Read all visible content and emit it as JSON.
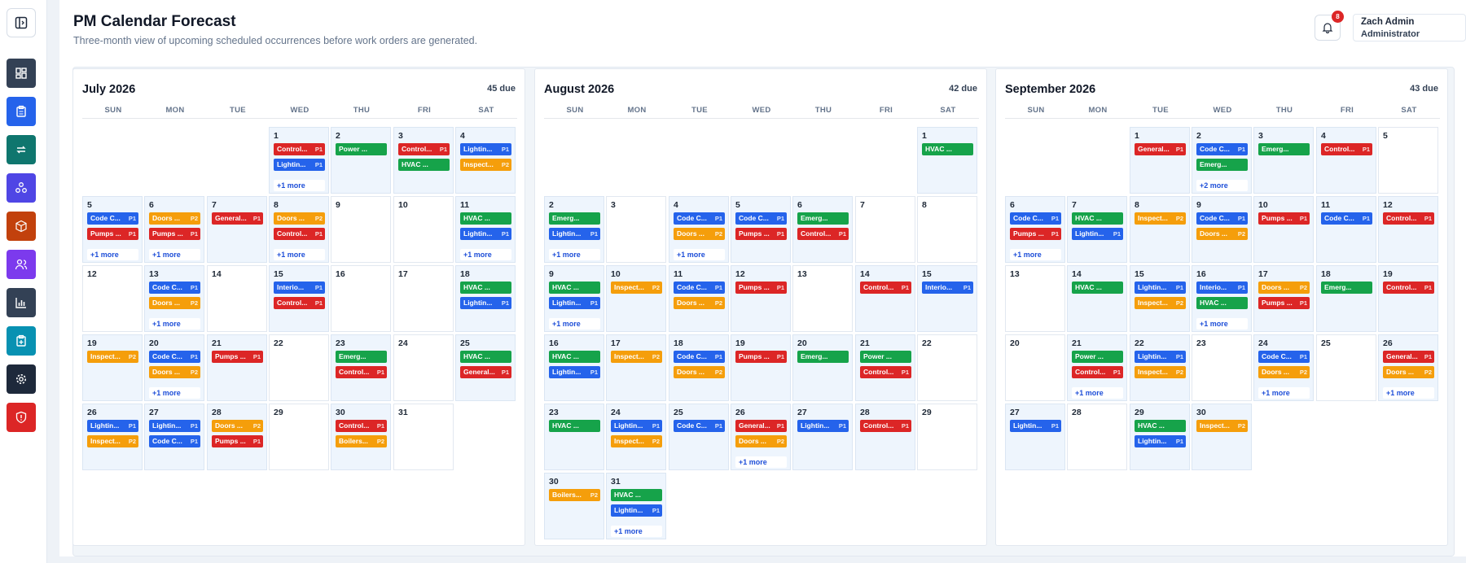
{
  "header": {
    "title": "PM Calendar Forecast",
    "subtitle": "Three-month view of upcoming scheduled occurrences before work orders are generated.",
    "notification_count": "8"
  },
  "user": {
    "name": "Zach Admin",
    "role": "Administrator"
  },
  "sidebar": {
    "items": [
      {
        "name": "dashboard",
        "icon": "grid-icon",
        "color": "#334155"
      },
      {
        "name": "work-orders",
        "icon": "clipboard-icon",
        "color": "#2563eb"
      },
      {
        "name": "pm-schedules",
        "icon": "repeat-icon",
        "color": "#0f766e"
      },
      {
        "name": "assets",
        "icon": "network-icon",
        "color": "#4f46e5"
      },
      {
        "name": "inventory",
        "icon": "box-icon",
        "color": "#c2410c"
      },
      {
        "name": "users",
        "icon": "users-icon",
        "color": "#7c3aed"
      },
      {
        "name": "reports",
        "icon": "bar-chart-icon",
        "color": "#334155"
      },
      {
        "name": "requests",
        "icon": "clipboard-plus-icon",
        "color": "#0891b2"
      },
      {
        "name": "settings",
        "icon": "gear-icon",
        "color": "#1e293b"
      },
      {
        "name": "safety",
        "icon": "shield-alert-icon",
        "color": "#dc2626"
      }
    ]
  },
  "weekdays": [
    "SUN",
    "MON",
    "TUE",
    "WED",
    "THU",
    "FRI",
    "SAT"
  ],
  "colors": {
    "blue": "#2563eb",
    "green": "#16a34a",
    "red": "#dc2626",
    "orange": "#f59e0b"
  },
  "months": [
    {
      "title": "July 2026",
      "due": "45 due",
      "start": 3,
      "days": 31,
      "events": {
        "1": {
          "c": [
            [
              "Control...",
              "P1",
              "red"
            ],
            [
              "Lightin...",
              "P1",
              "blue"
            ]
          ],
          "more": "+1 more"
        },
        "2": {
          "c": [
            [
              "Power ...",
              "",
              "green"
            ]
          ]
        },
        "3": {
          "c": [
            [
              "Control...",
              "P1",
              "red"
            ],
            [
              "HVAC ...",
              "",
              "green"
            ]
          ]
        },
        "4": {
          "c": [
            [
              "Lightin...",
              "P1",
              "blue"
            ],
            [
              "Inspect...",
              "P2",
              "orange"
            ]
          ]
        },
        "5": {
          "c": [
            [
              "Code C...",
              "P1",
              "blue"
            ],
            [
              "Pumps ...",
              "P1",
              "red"
            ]
          ],
          "more": "+1 more"
        },
        "6": {
          "c": [
            [
              "Doors ...",
              "P2",
              "orange"
            ],
            [
              "Pumps ...",
              "P1",
              "red"
            ]
          ],
          "more": "+1 more"
        },
        "7": {
          "c": [
            [
              "General...",
              "P1",
              "red"
            ]
          ]
        },
        "8": {
          "c": [
            [
              "Doors ...",
              "P2",
              "orange"
            ],
            [
              "Control...",
              "P1",
              "red"
            ]
          ],
          "more": "+1 more"
        },
        "11": {
          "c": [
            [
              "HVAC ...",
              "",
              "green"
            ],
            [
              "Lightin...",
              "P1",
              "blue"
            ]
          ],
          "more": "+1 more"
        },
        "13": {
          "c": [
            [
              "Code C...",
              "P1",
              "blue"
            ],
            [
              "Doors ...",
              "P2",
              "orange"
            ]
          ],
          "more": "+1 more"
        },
        "15": {
          "c": [
            [
              "Interio...",
              "P1",
              "blue"
            ],
            [
              "Control...",
              "P1",
              "red"
            ]
          ]
        },
        "18": {
          "c": [
            [
              "HVAC ...",
              "",
              "green"
            ],
            [
              "Lightin...",
              "P1",
              "blue"
            ]
          ]
        },
        "19": {
          "c": [
            [
              "Inspect...",
              "P2",
              "orange"
            ]
          ]
        },
        "20": {
          "c": [
            [
              "Code C...",
              "P1",
              "blue"
            ],
            [
              "Doors ...",
              "P2",
              "orange"
            ]
          ],
          "more": "+1 more"
        },
        "21": {
          "c": [
            [
              "Pumps ...",
              "P1",
              "red"
            ]
          ]
        },
        "23": {
          "c": [
            [
              "Emerg...",
              "",
              "green"
            ],
            [
              "Control...",
              "P1",
              "red"
            ]
          ]
        },
        "25": {
          "c": [
            [
              "HVAC ...",
              "",
              "green"
            ],
            [
              "General...",
              "P1",
              "red"
            ]
          ]
        },
        "26": {
          "c": [
            [
              "Lightin...",
              "P1",
              "blue"
            ],
            [
              "Inspect...",
              "P2",
              "orange"
            ]
          ]
        },
        "27": {
          "c": [
            [
              "Lightin...",
              "P1",
              "blue"
            ],
            [
              "Code C...",
              "P1",
              "blue"
            ]
          ]
        },
        "28": {
          "c": [
            [
              "Doors ...",
              "P2",
              "orange"
            ],
            [
              "Pumps ...",
              "P1",
              "red"
            ]
          ]
        },
        "30": {
          "c": [
            [
              "Control...",
              "P1",
              "red"
            ],
            [
              "Boilers...",
              "P2",
              "orange"
            ]
          ]
        }
      }
    },
    {
      "title": "August 2026",
      "due": "42 due",
      "start": 6,
      "days": 31,
      "events": {
        "1": {
          "c": [
            [
              "HVAC ...",
              "",
              "green"
            ]
          ]
        },
        "2": {
          "c": [
            [
              "Emerg...",
              "",
              "green"
            ],
            [
              "Lightin...",
              "P1",
              "blue"
            ]
          ],
          "more": "+1 more"
        },
        "4": {
          "c": [
            [
              "Code C...",
              "P1",
              "blue"
            ],
            [
              "Doors ...",
              "P2",
              "orange"
            ]
          ],
          "more": "+1 more"
        },
        "5": {
          "c": [
            [
              "Code C...",
              "P1",
              "blue"
            ],
            [
              "Pumps ...",
              "P1",
              "red"
            ]
          ]
        },
        "6": {
          "c": [
            [
              "Emerg...",
              "",
              "green"
            ],
            [
              "Control...",
              "P1",
              "red"
            ]
          ]
        },
        "9": {
          "c": [
            [
              "HVAC ...",
              "",
              "green"
            ],
            [
              "Lightin...",
              "P1",
              "blue"
            ]
          ],
          "more": "+1 more"
        },
        "10": {
          "c": [
            [
              "Inspect...",
              "P2",
              "orange"
            ]
          ]
        },
        "11": {
          "c": [
            [
              "Code C...",
              "P1",
              "blue"
            ],
            [
              "Doors ...",
              "P2",
              "orange"
            ]
          ]
        },
        "12": {
          "c": [
            [
              "Pumps ...",
              "P1",
              "red"
            ]
          ]
        },
        "14": {
          "c": [
            [
              "Control...",
              "P1",
              "red"
            ]
          ]
        },
        "15": {
          "c": [
            [
              "Interio...",
              "P1",
              "blue"
            ]
          ]
        },
        "16": {
          "c": [
            [
              "HVAC ...",
              "",
              "green"
            ],
            [
              "Lightin...",
              "P1",
              "blue"
            ]
          ]
        },
        "17": {
          "c": [
            [
              "Inspect...",
              "P2",
              "orange"
            ]
          ]
        },
        "18": {
          "c": [
            [
              "Code C...",
              "P1",
              "blue"
            ],
            [
              "Doors ...",
              "P2",
              "orange"
            ]
          ]
        },
        "19": {
          "c": [
            [
              "Pumps ...",
              "P1",
              "red"
            ]
          ]
        },
        "20": {
          "c": [
            [
              "Emerg...",
              "",
              "green"
            ]
          ]
        },
        "21": {
          "c": [
            [
              "Power ...",
              "",
              "green"
            ],
            [
              "Control...",
              "P1",
              "red"
            ]
          ]
        },
        "23": {
          "c": [
            [
              "HVAC ...",
              "",
              "green"
            ]
          ]
        },
        "24": {
          "c": [
            [
              "Lightin...",
              "P1",
              "blue"
            ],
            [
              "Inspect...",
              "P2",
              "orange"
            ]
          ]
        },
        "25": {
          "c": [
            [
              "Code C...",
              "P1",
              "blue"
            ]
          ]
        },
        "26": {
          "c": [
            [
              "General...",
              "P1",
              "red"
            ],
            [
              "Doors ...",
              "P2",
              "orange"
            ]
          ],
          "more": "+1 more"
        },
        "27": {
          "c": [
            [
              "Lightin...",
              "P1",
              "blue"
            ]
          ]
        },
        "28": {
          "c": [
            [
              "Control...",
              "P1",
              "red"
            ]
          ]
        },
        "30": {
          "c": [
            [
              "Boilers...",
              "P2",
              "orange"
            ]
          ]
        },
        "31": {
          "c": [
            [
              "HVAC ...",
              "",
              "green"
            ],
            [
              "Lightin...",
              "P1",
              "blue"
            ]
          ],
          "more": "+1 more"
        }
      }
    },
    {
      "title": "September 2026",
      "due": "43 due",
      "start": 2,
      "days": 30,
      "events": {
        "1": {
          "c": [
            [
              "General...",
              "P1",
              "red"
            ]
          ]
        },
        "2": {
          "c": [
            [
              "Code C...",
              "P1",
              "blue"
            ],
            [
              "Emerg...",
              "",
              "green"
            ]
          ],
          "more": "+2 more"
        },
        "3": {
          "c": [
            [
              "Emerg...",
              "",
              "green"
            ]
          ]
        },
        "4": {
          "c": [
            [
              "Control...",
              "P1",
              "red"
            ]
          ]
        },
        "6": {
          "c": [
            [
              "Code C...",
              "P1",
              "blue"
            ],
            [
              "Pumps ...",
              "P1",
              "red"
            ]
          ],
          "more": "+1 more"
        },
        "7": {
          "c": [
            [
              "HVAC ...",
              "",
              "green"
            ],
            [
              "Lightin...",
              "P1",
              "blue"
            ]
          ]
        },
        "8": {
          "c": [
            [
              "Inspect...",
              "P2",
              "orange"
            ]
          ]
        },
        "9": {
          "c": [
            [
              "Code C...",
              "P1",
              "blue"
            ],
            [
              "Doors ...",
              "P2",
              "orange"
            ]
          ]
        },
        "10": {
          "c": [
            [
              "Pumps ...",
              "P1",
              "red"
            ]
          ]
        },
        "11": {
          "c": [
            [
              "Code C...",
              "P1",
              "blue"
            ]
          ]
        },
        "12": {
          "c": [
            [
              "Control...",
              "P1",
              "red"
            ]
          ]
        },
        "14": {
          "c": [
            [
              "HVAC ...",
              "",
              "green"
            ]
          ]
        },
        "15": {
          "c": [
            [
              "Lightin...",
              "P1",
              "blue"
            ],
            [
              "Inspect...",
              "P2",
              "orange"
            ]
          ]
        },
        "16": {
          "c": [
            [
              "Interio...",
              "P1",
              "blue"
            ],
            [
              "HVAC ...",
              "",
              "green"
            ]
          ],
          "more": "+1 more"
        },
        "17": {
          "c": [
            [
              "Doors ...",
              "P2",
              "orange"
            ],
            [
              "Pumps ...",
              "P1",
              "red"
            ]
          ]
        },
        "18": {
          "c": [
            [
              "Emerg...",
              "",
              "green"
            ]
          ]
        },
        "19": {
          "c": [
            [
              "Control...",
              "P1",
              "red"
            ]
          ]
        },
        "21": {
          "c": [
            [
              "Power ...",
              "",
              "green"
            ],
            [
              "Control...",
              "P1",
              "red"
            ]
          ],
          "more": "+1 more"
        },
        "22": {
          "c": [
            [
              "Lightin...",
              "P1",
              "blue"
            ],
            [
              "Inspect...",
              "P2",
              "orange"
            ]
          ]
        },
        "24": {
          "c": [
            [
              "Code C...",
              "P1",
              "blue"
            ],
            [
              "Doors ...",
              "P2",
              "orange"
            ]
          ],
          "more": "+1 more"
        },
        "26": {
          "c": [
            [
              "General...",
              "P1",
              "red"
            ],
            [
              "Doors ...",
              "P2",
              "orange"
            ]
          ],
          "more": "+1 more"
        },
        "27": {
          "c": [
            [
              "Lightin...",
              "P1",
              "blue"
            ]
          ]
        },
        "29": {
          "c": [
            [
              "HVAC ...",
              "",
              "green"
            ],
            [
              "Lightin...",
              "P1",
              "blue"
            ]
          ]
        },
        "30": {
          "c": [
            [
              "Inspect...",
              "P2",
              "orange"
            ]
          ]
        }
      }
    }
  ]
}
